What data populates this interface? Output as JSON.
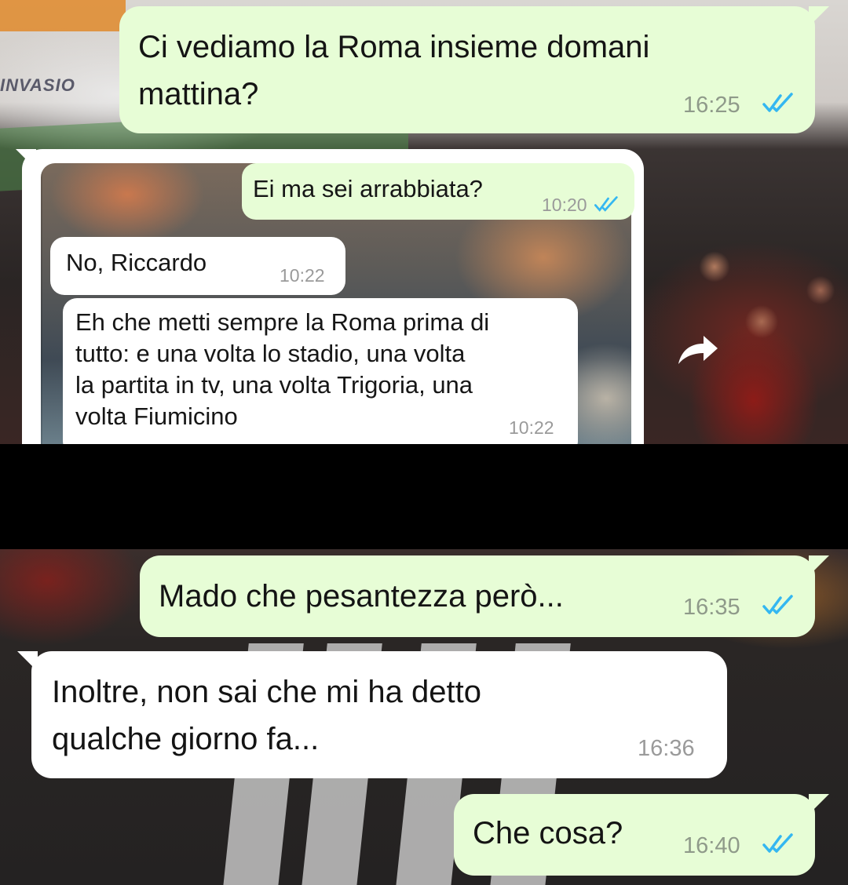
{
  "background": {
    "banner_text": "INVASIO"
  },
  "chat": {
    "messages": [
      {
        "id": "m1",
        "direction": "outgoing",
        "text_line1": "Ci vediamo la Roma insieme domani",
        "text_line2": "mattina?",
        "time": "16:25",
        "status": "read"
      },
      {
        "id": "m2",
        "direction": "outgoing",
        "text": "Mado che pesantezza però...",
        "time": "16:35",
        "status": "read"
      },
      {
        "id": "m3",
        "direction": "incoming",
        "text_line1": "Inoltre, non sai che mi ha detto",
        "text_line2": "qualche giorno fa...",
        "time": "16:36"
      },
      {
        "id": "m4",
        "direction": "outgoing",
        "text": "Che cosa?",
        "time": "16:40",
        "status": "read"
      }
    ],
    "forwarded_screenshot": {
      "messages": [
        {
          "direction": "outgoing",
          "text": "Ei ma sei arrabbiata?",
          "time": "10:20",
          "status": "read"
        },
        {
          "direction": "incoming",
          "text": "No, Riccardo",
          "time": "10:22"
        },
        {
          "direction": "incoming",
          "lines": [
            "Eh che metti sempre la Roma prima di",
            "tutto: e una volta lo stadio, una volta",
            "la partita in tv, una volta Trigoria, una",
            "volta Fiumicino"
          ],
          "time": "10:22"
        }
      ]
    }
  },
  "colors": {
    "outgoing_bubble": "#e7fdd6",
    "incoming_bubble": "#ffffff",
    "read_ticks": "#34b7f1",
    "redaction_band": "#000000"
  },
  "icons": {
    "read_receipt": "double-check-icon",
    "forward": "forward-arrow-icon"
  }
}
